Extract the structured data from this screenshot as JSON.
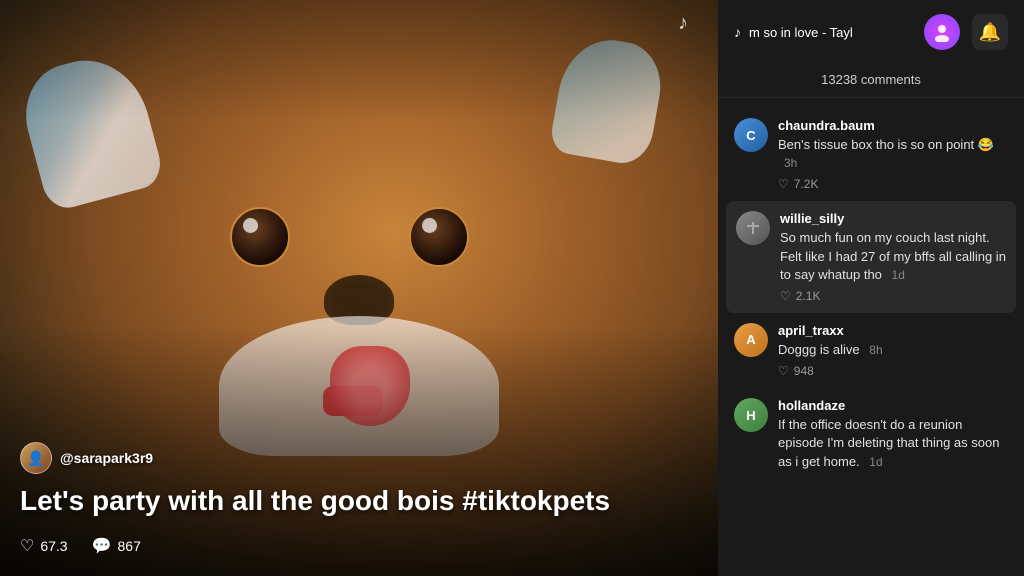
{
  "video": {
    "username": "@sarapark3r9",
    "caption": "Let's party with all the good bois #tiktokpets",
    "likes": "67.3",
    "comments_count_video": "867"
  },
  "topbar": {
    "song_text": "m so in love - Tayl",
    "music_note": "♪"
  },
  "comments_panel": {
    "count_label": "13238 comments",
    "comments": [
      {
        "id": 1,
        "username": "chaundra.baum",
        "text": "Ben's tissue box tho is so on point 😂",
        "timestamp": "3h",
        "likes": "7.2K",
        "highlighted": false
      },
      {
        "id": 2,
        "username": "willie_silly",
        "text": "So much fun on my couch last night. Felt like I had 27 of my bffs all calling in to say whatup tho",
        "timestamp": "1d",
        "likes": "2.1K",
        "highlighted": true
      },
      {
        "id": 3,
        "username": "april_traxx",
        "text": "Doggg is alive",
        "timestamp": "8h",
        "likes": "948",
        "highlighted": false
      },
      {
        "id": 4,
        "username": "hollandaze",
        "text": "If the office doesn't do a reunion episode I'm deleting that thing as soon as i get home.",
        "timestamp": "1d",
        "likes": "",
        "highlighted": false
      }
    ]
  },
  "icons": {
    "bell": "🔔",
    "heart": "♡",
    "chat": "💬",
    "music_note_float": "♪"
  }
}
